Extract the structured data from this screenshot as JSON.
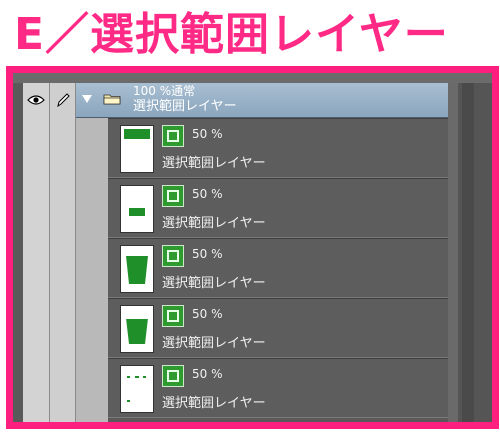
{
  "title": "E／選択範囲レイヤー",
  "folder": {
    "mode": "100 %通常",
    "name": "選択範囲レイヤー"
  },
  "layers": [
    {
      "opacity": "50 %",
      "name": "選択範囲レイヤー"
    },
    {
      "opacity": "50 %",
      "name": "選択範囲レイヤー"
    },
    {
      "opacity": "50 %",
      "name": "選択範囲レイヤー"
    },
    {
      "opacity": "50 %",
      "name": "選択範囲レイヤー"
    },
    {
      "opacity": "50 %",
      "name": "選択範囲レイヤー"
    }
  ],
  "colors": {
    "accent": "#ff1f7f",
    "mask_green": "#2f9a2f",
    "selection": "#8aa5bd"
  }
}
